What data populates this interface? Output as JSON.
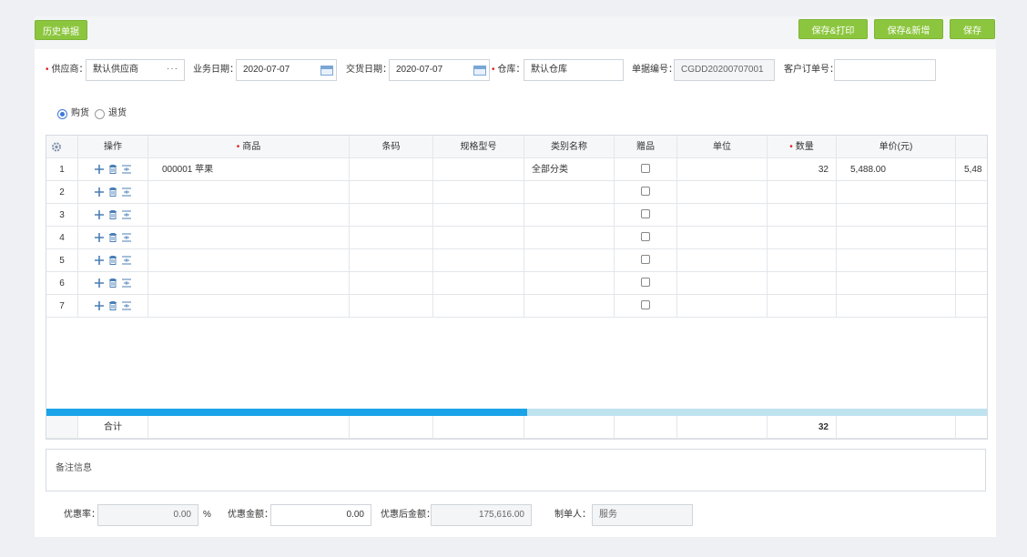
{
  "toolbar": {
    "history_label": "历史单据",
    "save_print_label": "保存&打印",
    "save_new_label": "保存&新增",
    "save_label": "保存"
  },
  "form": {
    "supplier_label": "供应商：",
    "supplier_value": "默认供应商",
    "supplier_more": "···",
    "biz_date_label": "业务日期：",
    "biz_date_value": "2020-07-07",
    "delivery_date_label": "交货日期：",
    "delivery_date_value": "2020-07-07",
    "warehouse_label": "仓库：",
    "warehouse_value": "默认仓库",
    "doc_no_label": "单据编号：",
    "doc_no_value": "CGDD20200707001",
    "customer_order_label": "客户订单号：",
    "customer_order_value": ""
  },
  "mode": {
    "purchase_label": "购货",
    "return_label": "退货",
    "selected": "purchase"
  },
  "table": {
    "headers": {
      "ops": "操作",
      "product": "商品",
      "barcode": "条码",
      "spec": "规格型号",
      "category": "类别名称",
      "gift": "赠品",
      "unit": "单位",
      "qty": "数量",
      "price": "单价(元)"
    },
    "rows": [
      {
        "no": "1",
        "product": "000001 苹果",
        "category": "全部分类",
        "qty": "32",
        "price": "5,488.00",
        "amount": "5,48"
      },
      {
        "no": "2",
        "product": "",
        "category": "",
        "qty": "",
        "price": "",
        "amount": ""
      },
      {
        "no": "3",
        "product": "",
        "category": "",
        "qty": "",
        "price": "",
        "amount": ""
      },
      {
        "no": "4",
        "product": "",
        "category": "",
        "qty": "",
        "price": "",
        "amount": ""
      },
      {
        "no": "5",
        "product": "",
        "category": "",
        "qty": "",
        "price": "",
        "amount": ""
      },
      {
        "no": "6",
        "product": "",
        "category": "",
        "qty": "",
        "price": "",
        "amount": ""
      },
      {
        "no": "7",
        "product": "",
        "category": "",
        "qty": "",
        "price": "",
        "amount": ""
      }
    ],
    "total_label": "合计",
    "total_qty": "32"
  },
  "remark": {
    "label": "备注信息"
  },
  "footer": {
    "discount_rate_label": "优惠率：",
    "discount_rate_value": "0.00",
    "percent": "%",
    "discount_amount_label": "优惠金额：",
    "discount_amount_value": "0.00",
    "after_discount_label": "优惠后金额：",
    "after_discount_value": "175,616.00",
    "maker_label": "制单人：",
    "maker_value": "服务"
  },
  "colors": {
    "accent_green": "#8cc63f",
    "scroll_blue": "#1aa3e8",
    "required_red": "#e02020"
  }
}
